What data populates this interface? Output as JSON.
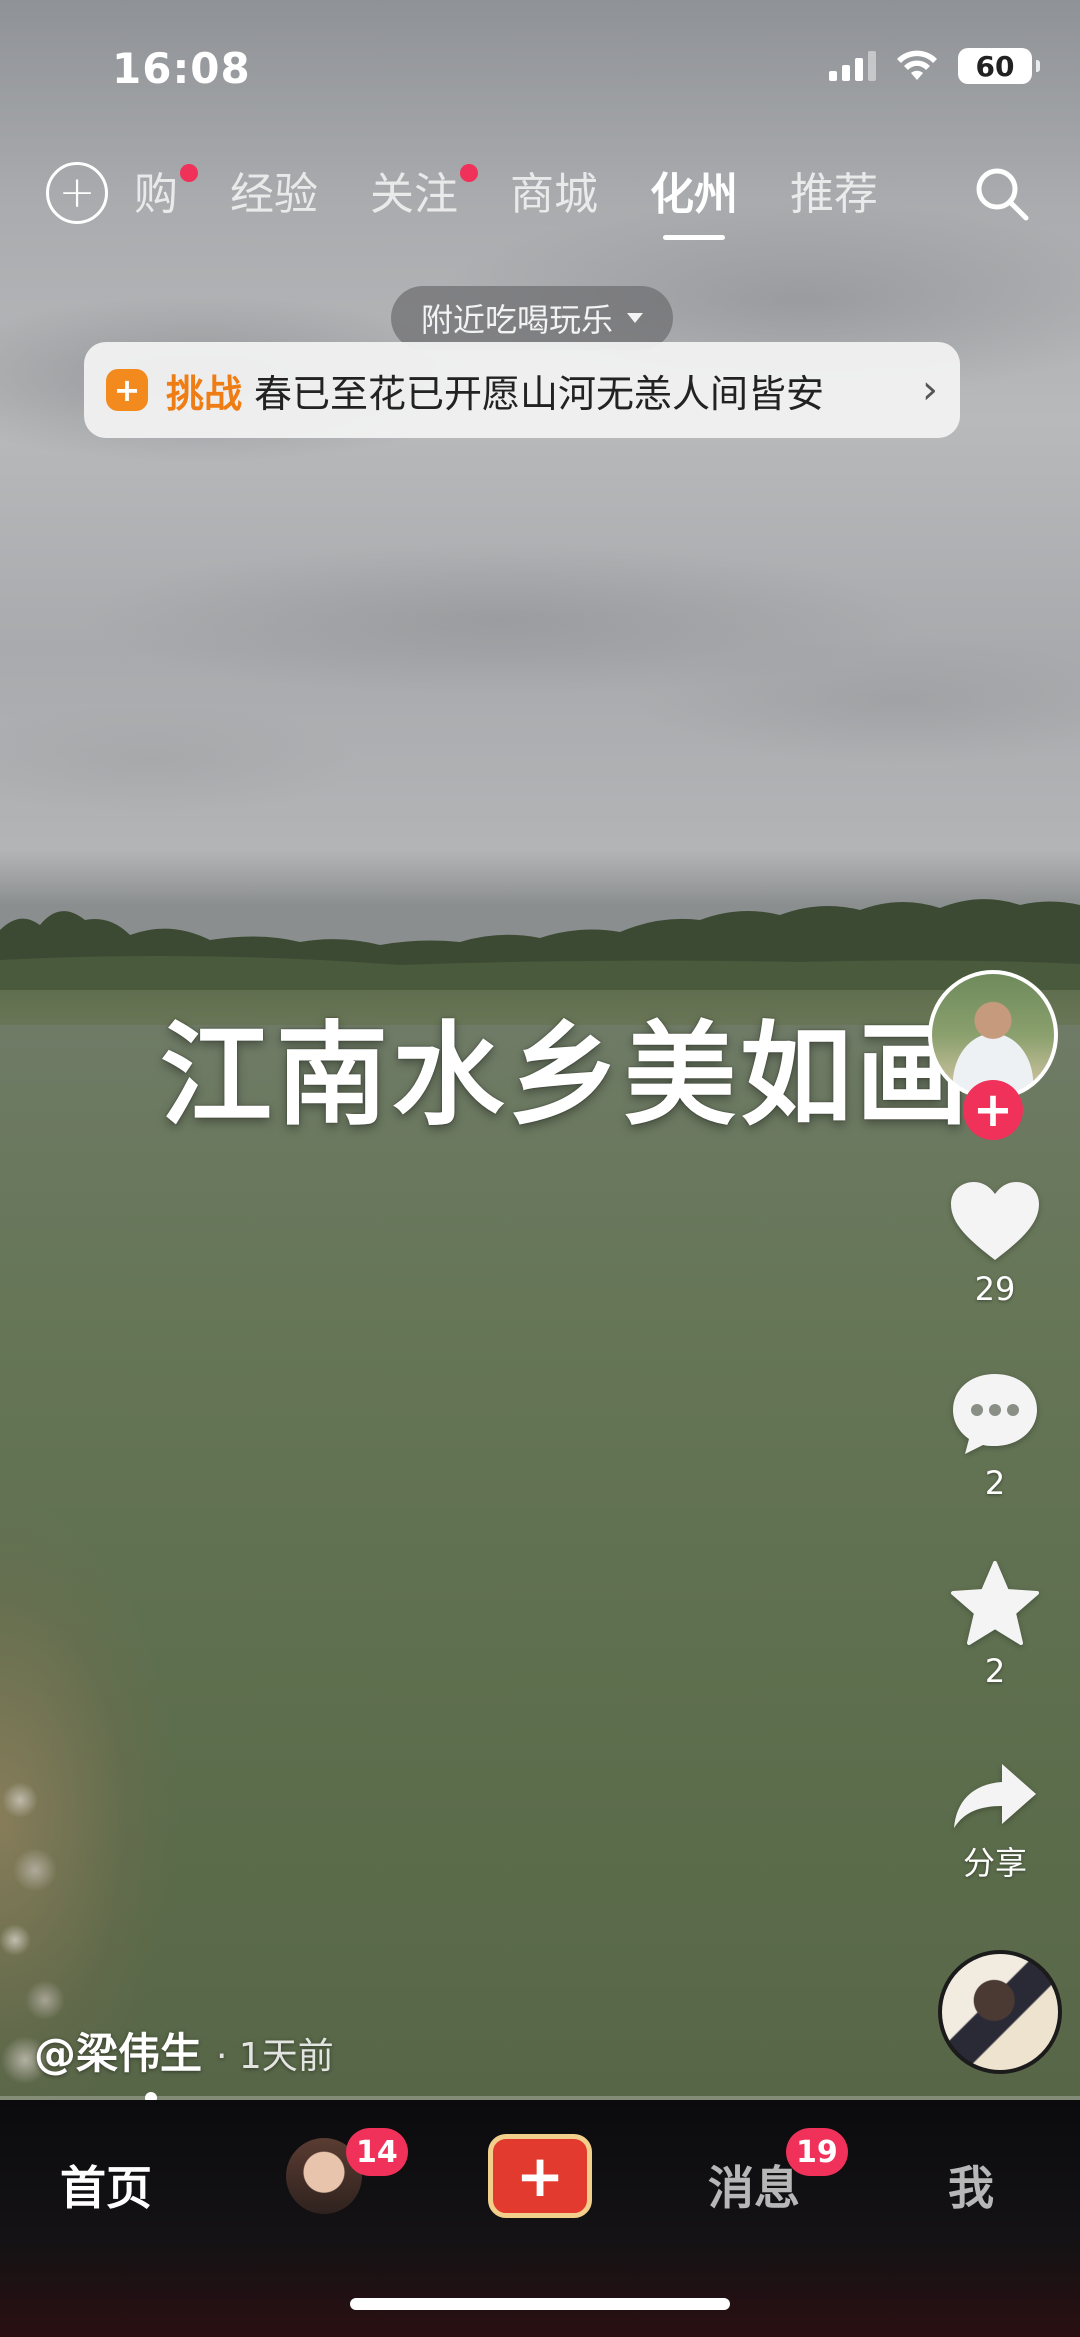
{
  "status_bar": {
    "time": "16:08",
    "battery": "60"
  },
  "top_nav": {
    "tabs": [
      {
        "label": "购",
        "dot": true
      },
      {
        "label": "经验",
        "dot": false
      },
      {
        "label": "关注",
        "dot": true
      },
      {
        "label": "商城",
        "dot": false
      },
      {
        "label": "化州",
        "dot": false,
        "active": true
      },
      {
        "label": "推荐",
        "dot": false
      }
    ]
  },
  "nearby_pill": {
    "label": "附近吃喝玩乐"
  },
  "challenge": {
    "tag": "挑战",
    "title": "春已至花已开愿山河无恙人间皆安"
  },
  "video": {
    "caption": "江南水乡美如画",
    "author": "@梁伟生",
    "posted": "· 1天前",
    "progress_fraction": 0.14
  },
  "actions": {
    "likes": "29",
    "comments": "2",
    "favorites": "2",
    "share_label": "分享"
  },
  "bottom_bar": {
    "home": "首页",
    "friends_badge": "14",
    "messages": "消息",
    "messages_badge": "19",
    "me": "我"
  },
  "colors": {
    "accent_red": "#f0315a",
    "challenge_orange": "#ef7d15",
    "add_button_red": "#e33a30"
  }
}
